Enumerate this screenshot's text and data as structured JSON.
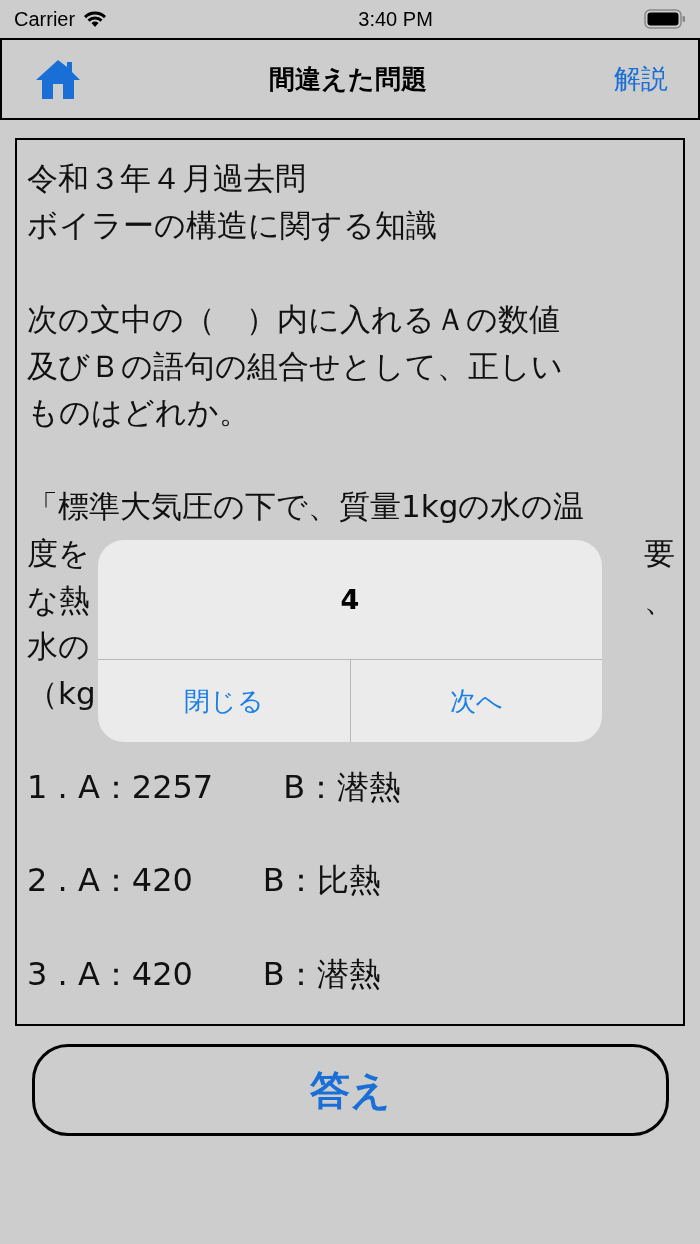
{
  "status_bar": {
    "carrier": "Carrier",
    "time": "3:40 PM"
  },
  "nav_bar": {
    "title": "間違えた問題",
    "right_button": "解説"
  },
  "question": {
    "lines": [
      {
        "kind": "text",
        "left": "令和３年４月過去問"
      },
      {
        "kind": "text",
        "left": "ボイラーの構造に関する知識"
      },
      {
        "kind": "blank"
      },
      {
        "kind": "text",
        "left": "次の文中の（　）内に入れるＡの数値"
      },
      {
        "kind": "text",
        "left": "及びＢの語句の組合せとして、正しい"
      },
      {
        "kind": "text",
        "left": "ものはどれか。"
      },
      {
        "kind": "blank"
      },
      {
        "kind": "text",
        "left": "「標準大気圧の下で、質量1kgの水の温"
      },
      {
        "kind": "text",
        "left": "度を",
        "right": "要"
      },
      {
        "kind": "text",
        "left": "な熱",
        "right": "、"
      },
      {
        "kind": "text",
        "left": "水の"
      },
      {
        "kind": "text",
        "left": "（kg"
      },
      {
        "kind": "blank"
      },
      {
        "kind": "choice",
        "a": "1 . A：2257",
        "b": "B：潜熱"
      },
      {
        "kind": "blank"
      },
      {
        "kind": "choice",
        "a": "2 . A：420",
        "b": "B：比熱"
      },
      {
        "kind": "blank"
      },
      {
        "kind": "choice",
        "a": "3 . A：420",
        "b": "B：潜熱"
      }
    ]
  },
  "answer_button": "答え",
  "alert": {
    "title": "4",
    "buttons": [
      "閉じる",
      "次へ"
    ]
  }
}
